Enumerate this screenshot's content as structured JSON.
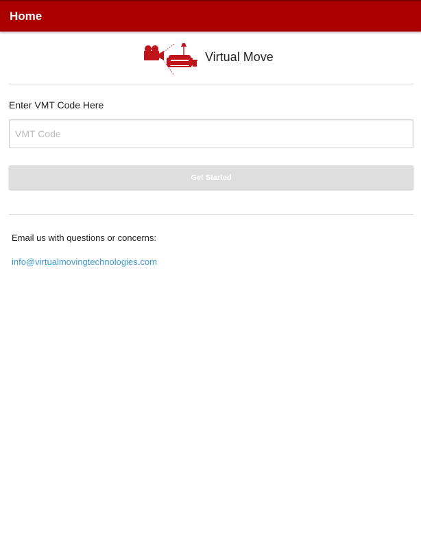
{
  "app_bar": {
    "title": "Home",
    "color": "#aa0000"
  },
  "brand": {
    "name": "Virtual Move",
    "logo_icon": "camera-sofa-logo-icon",
    "logo_color": "#c0141c"
  },
  "code_form": {
    "label": "Enter VMT Code Here",
    "input_value": "",
    "input_placeholder": "VMT Code",
    "button_label": "Get Started"
  },
  "contact": {
    "text": "Email us with questions or concerns:",
    "email": "info@virtualmovingtechnologies.com",
    "link_color": "#3d9bd1"
  }
}
